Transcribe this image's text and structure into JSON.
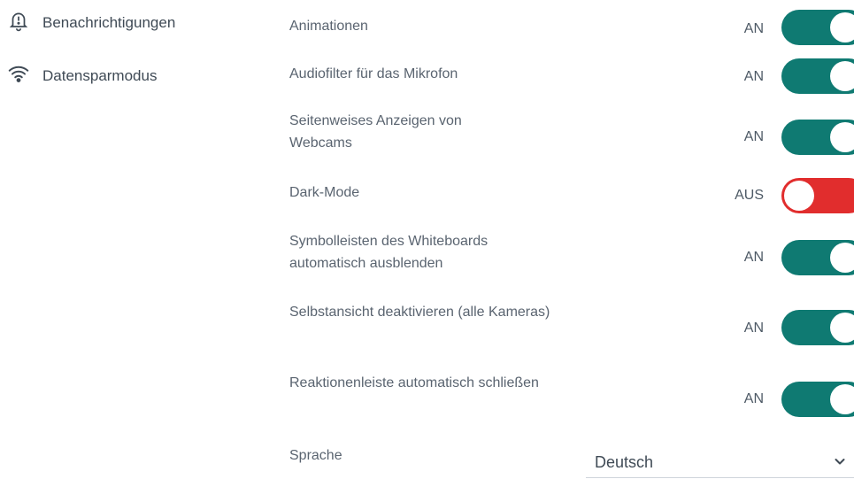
{
  "sidebar": {
    "items": [
      {
        "label": "Benachrichtigungen",
        "icon": "bell-alert-icon"
      },
      {
        "label": "Datensparmodus",
        "icon": "wifi-icon"
      }
    ]
  },
  "settings": [
    {
      "label": "Animationen",
      "state": "AN",
      "on": true
    },
    {
      "label": "Audiofilter für das Mikrofon",
      "state": "AN",
      "on": true
    },
    {
      "label": "Seitenweises Anzeigen von Webcams",
      "state": "AN",
      "on": true
    },
    {
      "label": "Dark-Mode",
      "state": "AUS",
      "on": false
    },
    {
      "label": "Symbolleisten des Whiteboards automatisch ausblenden",
      "state": "AN",
      "on": true
    },
    {
      "label": "Selbstansicht deaktivieren (alle Kameras)",
      "state": "AN",
      "on": true
    },
    {
      "label": "Reaktionenleiste automatisch schließen",
      "state": "AN",
      "on": true
    }
  ],
  "language": {
    "label": "Sprache",
    "selected": "Deutsch"
  },
  "colors": {
    "toggle_on": "#0f7a72",
    "toggle_off": "#e12d2d"
  }
}
